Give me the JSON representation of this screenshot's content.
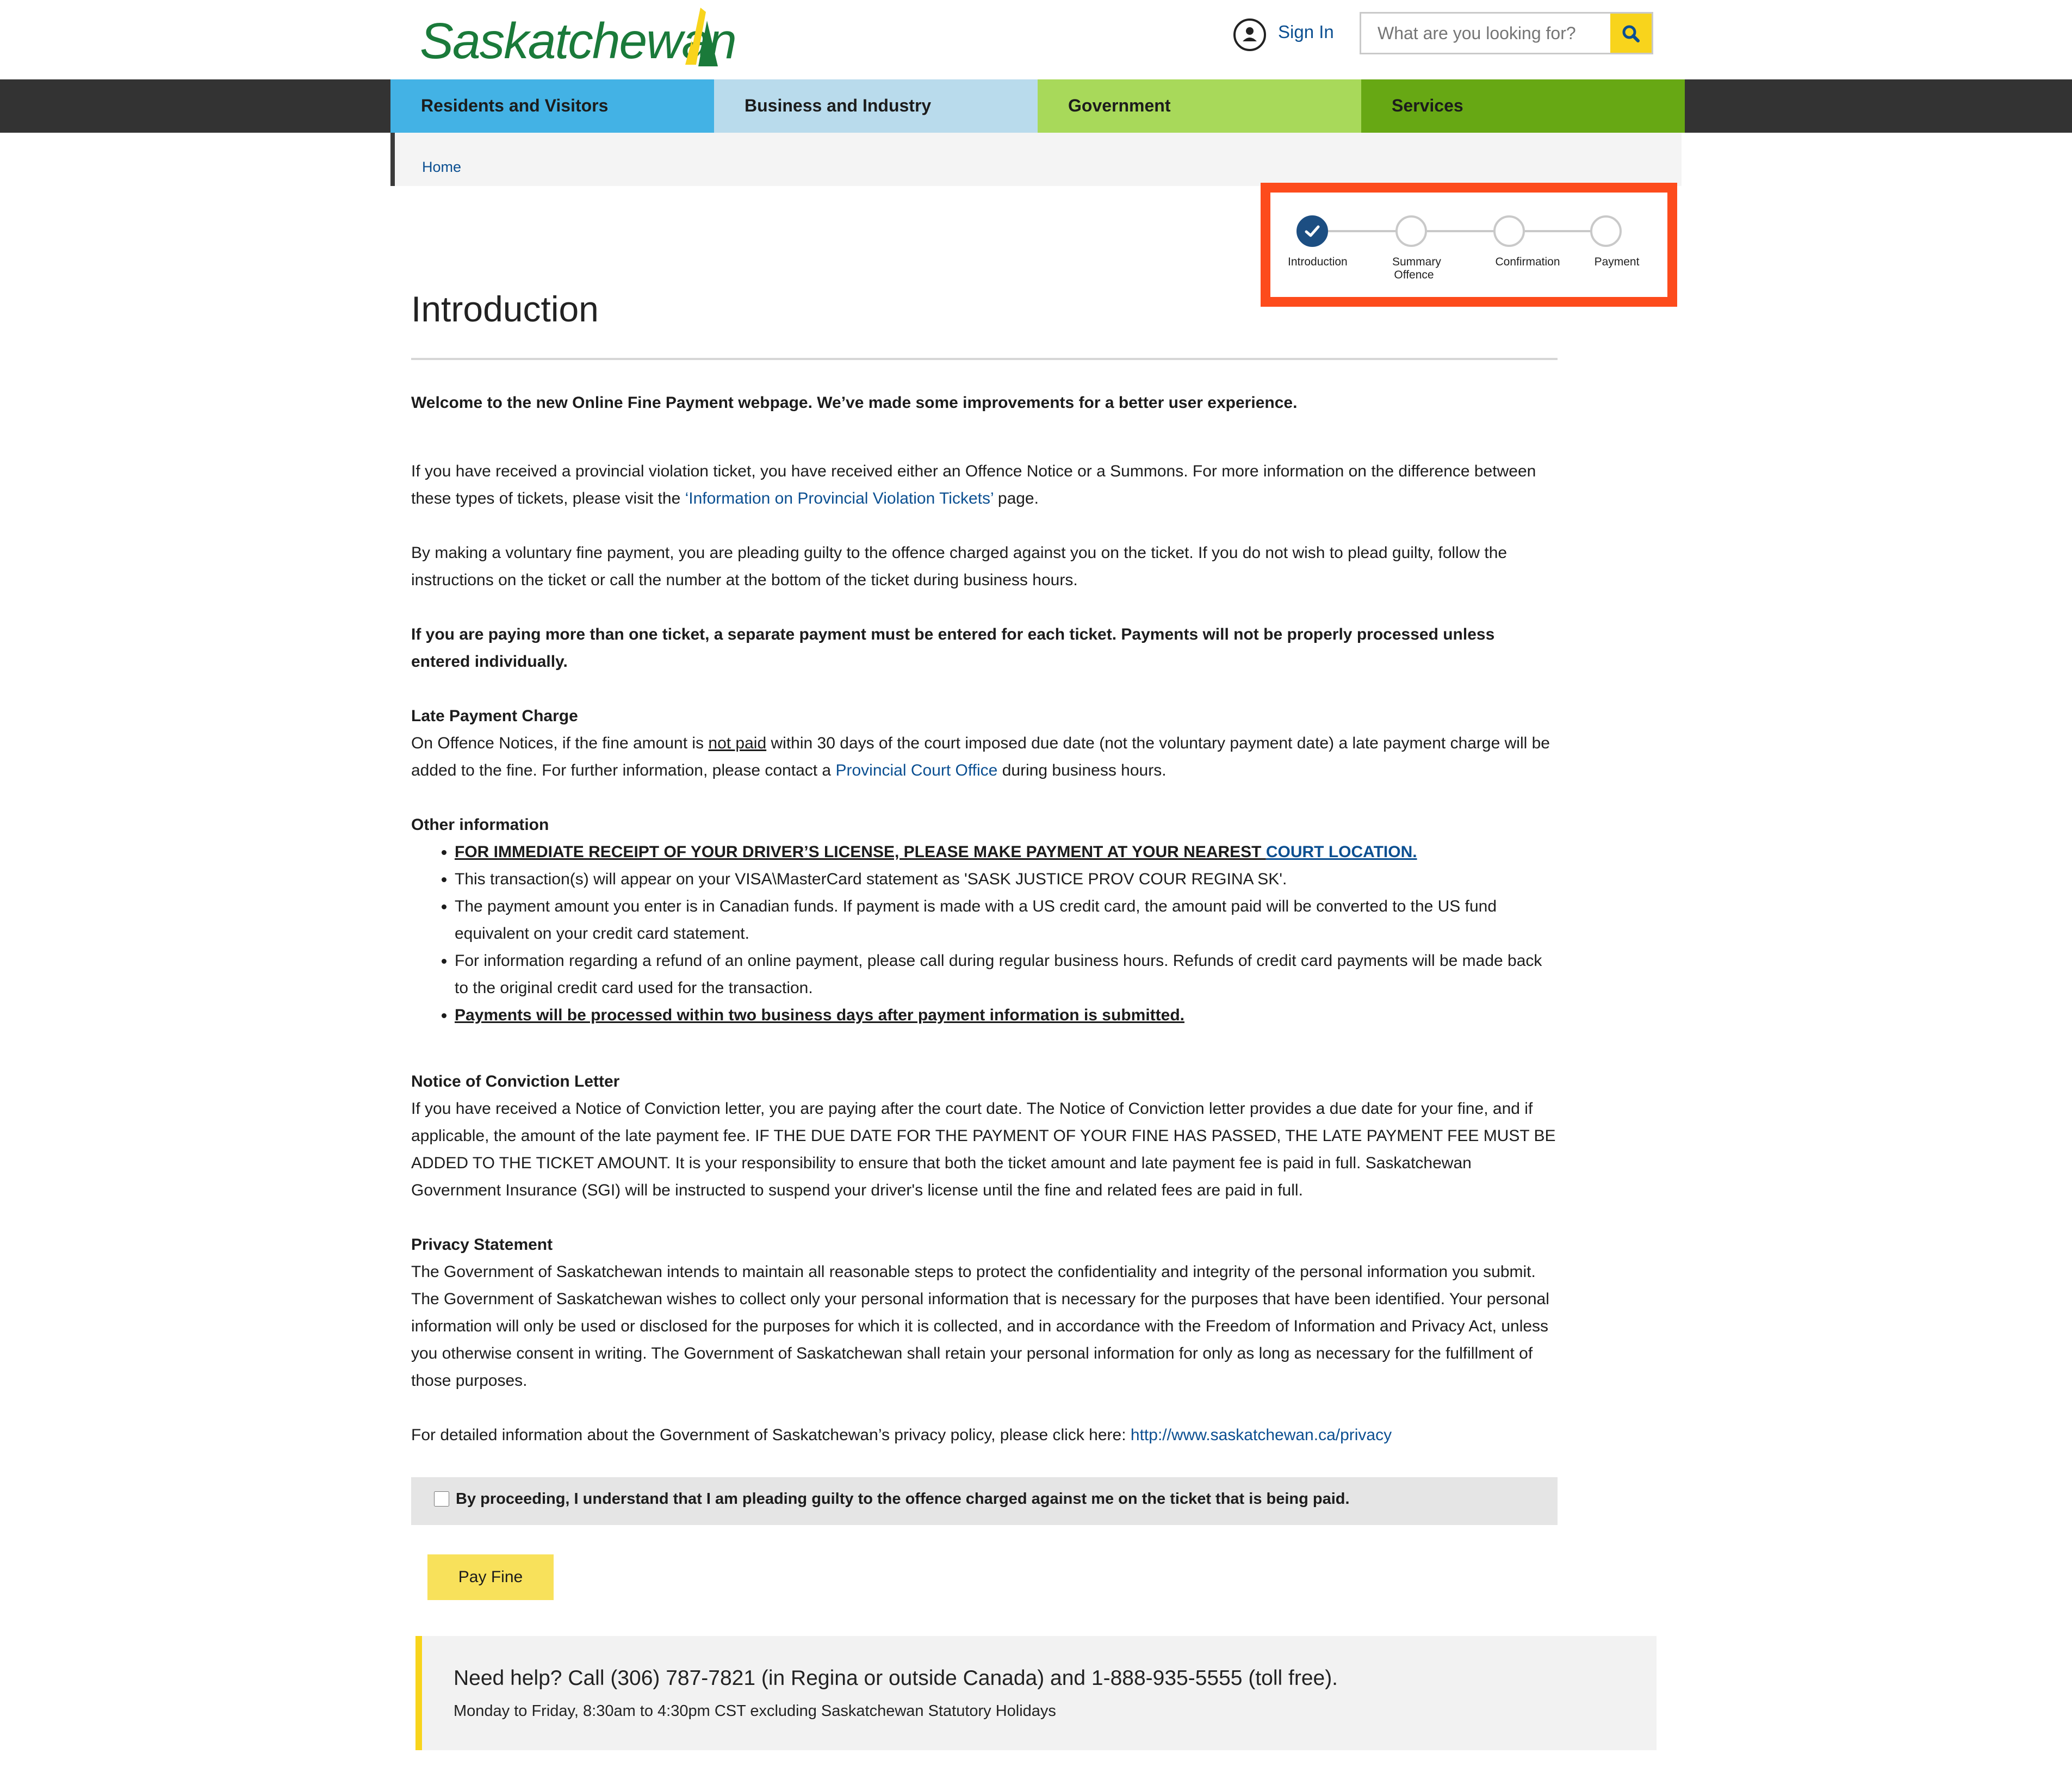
{
  "header": {
    "logo_text": "Saskatchewan",
    "sign_in": "Sign In",
    "search_placeholder": "What are you looking for?"
  },
  "nav": [
    {
      "label": "Residents and Visitors",
      "color": "#43b2e5"
    },
    {
      "label": "Business and Industry",
      "color": "#b9dbec"
    },
    {
      "label": "Government",
      "color": "#a8d95a"
    },
    {
      "label": "Services",
      "color": "#67a814"
    }
  ],
  "breadcrumb": {
    "home": "Home"
  },
  "progress": {
    "steps": [
      {
        "label": "Introduction",
        "status": "complete"
      },
      {
        "label": "Summary Offence",
        "status": "pending"
      },
      {
        "label": "Confirmation",
        "status": "pending"
      },
      {
        "label": "Payment",
        "status": "pending"
      }
    ],
    "highlight_color": "#fd4b1c"
  },
  "page": {
    "title": "Introduction",
    "welcome": "Welcome to the new Online Fine Payment webpage. We’ve made some improvements for a better user experience.",
    "p1_a": "If you have received a provincial violation ticket, you have received either an Offence Notice or a Summons. For more information on the difference between these types of tickets, please visit the ",
    "p1_link": "‘Information on Provincial Violation Tickets’",
    "p1_b": " page.",
    "p2": "By making a voluntary fine payment, you are pleading guilty to the offence charged against you on the ticket. If you do not wish to plead guilty, follow the instructions on the ticket or call the number at the bottom of the ticket during business hours.",
    "p3": "If you are paying more than one ticket, a separate payment must be entered for each ticket. Payments will not be properly processed unless entered individually.",
    "late_heading": "Late Payment Charge",
    "late_a": "On Offence Notices, if the fine amount is ",
    "late_underline": "not paid",
    "late_b": " within 30 days of the court imposed due date (not the voluntary payment date) a late payment charge will be added to the fine. For further information, please contact a ",
    "late_link": "Provincial Court Office",
    "late_c": " during business hours.",
    "other_heading": "Other information",
    "other_1a": "FOR IMMEDIATE RECEIPT OF YOUR DRIVER’S LICENSE, PLEASE MAKE PAYMENT AT YOUR NEAREST ",
    "other_1link": "COURT LOCATION.",
    "other_2": "This transaction(s) will appear on your VISA\\MasterCard statement as 'SASK JUSTICE PROV COUR REGINA SK'.",
    "other_3": "The payment amount you enter is in Canadian funds. If payment is made with a US credit card, the amount paid will be converted to the US fund equivalent on your credit card statement.",
    "other_4": "For information regarding a refund of an online payment, please call during regular business hours. Refunds of credit card payments will be made back to the original credit card used for the transaction.",
    "other_5": "Payments will be processed within two business days after payment information is submitted.",
    "notice_heading": "Notice of Conviction Letter",
    "notice_text": "If you have received a Notice of Conviction letter, you are paying after the court date. The Notice of Conviction letter provides a due date for your fine, and if applicable, the amount of the late payment fee. IF THE DUE DATE FOR THE PAYMENT OF YOUR FINE HAS PASSED, THE LATE PAYMENT FEE MUST BE ADDED TO THE TICKET AMOUNT. It is your responsibility to ensure that both the ticket amount and late payment fee is paid in full. Saskatchewan Government Insurance (SGI) will be instructed to suspend your driver's license until the fine and related fees are paid in full.",
    "privacy_heading": "Privacy Statement",
    "privacy_text": "The Government of Saskatchewan intends to maintain all reasonable steps to protect the confidentiality and integrity of the personal information you submit. The Government of Saskatchewan wishes to collect only your personal information that is necessary for the purposes that have been identified. Your personal information will only be used or disclosed for the purposes for which it is collected, and in accordance with the Freedom of Information and Privacy Act, unless you otherwise consent in writing. The Government of Saskatchewan shall retain your personal information for only as long as necessary for the fulfillment of those purposes.",
    "privacy_link_prefix": "For detailed information about the Government of Saskatchewan’s privacy policy, please click here: ",
    "privacy_link": "http://www.saskatchewan.ca/privacy"
  },
  "consent": {
    "text": "By proceeding, I understand that I am pleading guilty to the offence charged against me on the ticket that is being paid.",
    "checked": false
  },
  "pay_button": "Pay Fine",
  "help": {
    "title": "Need help? Call (306) 787-7821 (in Regina or outside Canada) and 1-888-935-5555 (toll free).",
    "hours": "Monday to Friday, 8:30am to 4:30pm CST excluding Saskatchewan Statutory Holidays"
  }
}
